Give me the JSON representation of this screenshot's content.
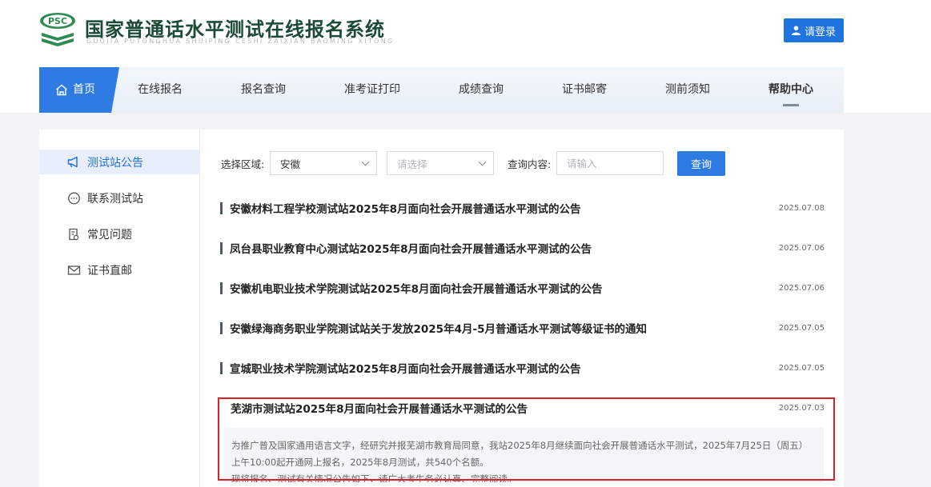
{
  "header": {
    "logo_text": "PSC",
    "title": "国家普通话水平测试在线报名系统",
    "subtitle": "GUOJIA PUTONGHUA SHUIPING CESHI ZAIXIAN BAOMING XITONG",
    "login_label": "请登录"
  },
  "nav": {
    "items": [
      {
        "label": "首页",
        "active": true
      },
      {
        "label": "在线报名"
      },
      {
        "label": "报名查询"
      },
      {
        "label": "准考证打印"
      },
      {
        "label": "成绩查询"
      },
      {
        "label": "证书邮寄"
      },
      {
        "label": "测前须知"
      },
      {
        "label": "帮助中心"
      }
    ]
  },
  "sidebar": {
    "items": [
      {
        "label": "测试站公告",
        "icon": "megaphone-icon",
        "active": true
      },
      {
        "label": "联系测试站",
        "icon": "chat-icon"
      },
      {
        "label": "常见问题",
        "icon": "question-doc-icon"
      },
      {
        "label": "证书直邮",
        "icon": "mail-icon"
      }
    ]
  },
  "filters": {
    "region_label": "选择区域:",
    "region_value": "安徽",
    "second_placeholder": "请选择",
    "query_label": "查询内容:",
    "query_placeholder": "请输入",
    "query_button": "查询"
  },
  "news": [
    {
      "title": "安徽材料工程学校测试站2025年8月面向社会开展普通话水平测试的公告",
      "date": "2025.07.08"
    },
    {
      "title": "凤台县职业教育中心测试站2025年8月面向社会开展普通话水平测试的公告",
      "date": "2025.07.06"
    },
    {
      "title": "安徽机电职业技术学院测试站2025年8月面向社会开展普通话水平测试的公告",
      "date": "2025.07.06"
    },
    {
      "title": "安徽绿海商务职业学院测试站关于发放2025年4月-5月普通话水平测试等级证书的通知",
      "date": "2025.07.05"
    },
    {
      "title": "宣城职业技术学院测试站2025年8月面向社会开展普通话水平测试的公告",
      "date": "2025.07.05"
    },
    {
      "title": "芜湖市测试站2025年8月面向社会开展普通话水平测试的公告",
      "date": "2025.07.03"
    }
  ],
  "highlighted_summary": {
    "line1": "为推广普及国家通用语言文字，经研究并报芜湖市教育局同意，我站2025年8月继续面向社会开展普通话水平测试，2025年7月25日（周五）",
    "line2": "上午10:00起开通网上报名，2025年8月测试，共540个名额。",
    "line3": "现将报名、测试有关情况公告如下，请广大考生务必认真、完整阅读。"
  },
  "colors": {
    "brand_green": "#1b4b34",
    "primary_blue": "#2d7be3",
    "highlight_red": "#d8222a"
  }
}
